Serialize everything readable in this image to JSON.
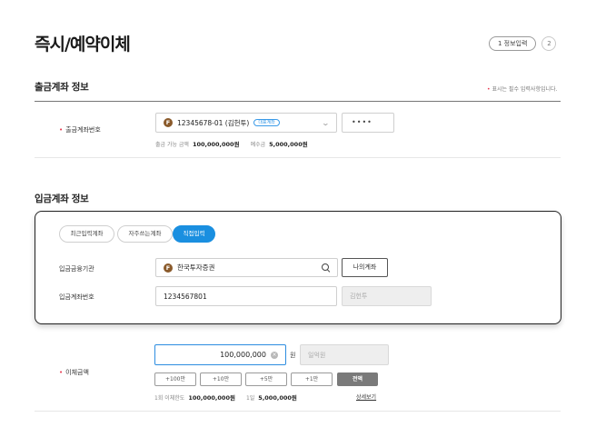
{
  "page": {
    "title": "즉시/예약이체",
    "steps": {
      "current_label": "1 정보입력",
      "next_label": "2"
    }
  },
  "withdraw": {
    "section_title": "출금계좌 정보",
    "required_note": "표시는 필수 입력사항입니다.",
    "account_label": "출금계좌번호",
    "account_value": "12345678-01 (김헌투)",
    "account_badge": "대표계좌",
    "brand_icon_letter": "F",
    "password_mask": "••••",
    "available_label": "출금 가능 금액",
    "available_value": "100,000,000원",
    "deposit_label": "예수금",
    "deposit_value": "5,000,000원"
  },
  "deposit": {
    "section_title": "입금계좌 정보",
    "tabs": [
      {
        "label": "최근입력계좌",
        "active": false
      },
      {
        "label": "자주쓰는계좌",
        "active": false
      },
      {
        "label": "직접입력",
        "active": true
      }
    ],
    "bank_label": "입금금융기관",
    "bank_value": "한국투자증권",
    "my_accounts_button": "나의계좌",
    "account_label": "입금계좌번호",
    "account_value": "1234567801",
    "holder_placeholder": "김헌투"
  },
  "transfer": {
    "amount_label": "이체금액",
    "amount_value": "100,000,000",
    "currency_unit": "원",
    "recipient_placeholder": "일억원",
    "quick_buttons": [
      "+100만",
      "+10만",
      "+5만",
      "+1만",
      "전액"
    ],
    "limit_once_label": "1회 이체한도",
    "limit_once_value": "100,000,000원",
    "limit_day_label": "1일",
    "limit_day_value": "5,000,000원",
    "details_link": "상세보기"
  },
  "colors": {
    "accent": "#1a8fe0",
    "required_star": "#e8384f",
    "brand_icon": "#8a5a2b"
  },
  "icons": [
    "brand-f-icon",
    "chevron-down-icon",
    "search-icon",
    "clear-icon"
  ]
}
